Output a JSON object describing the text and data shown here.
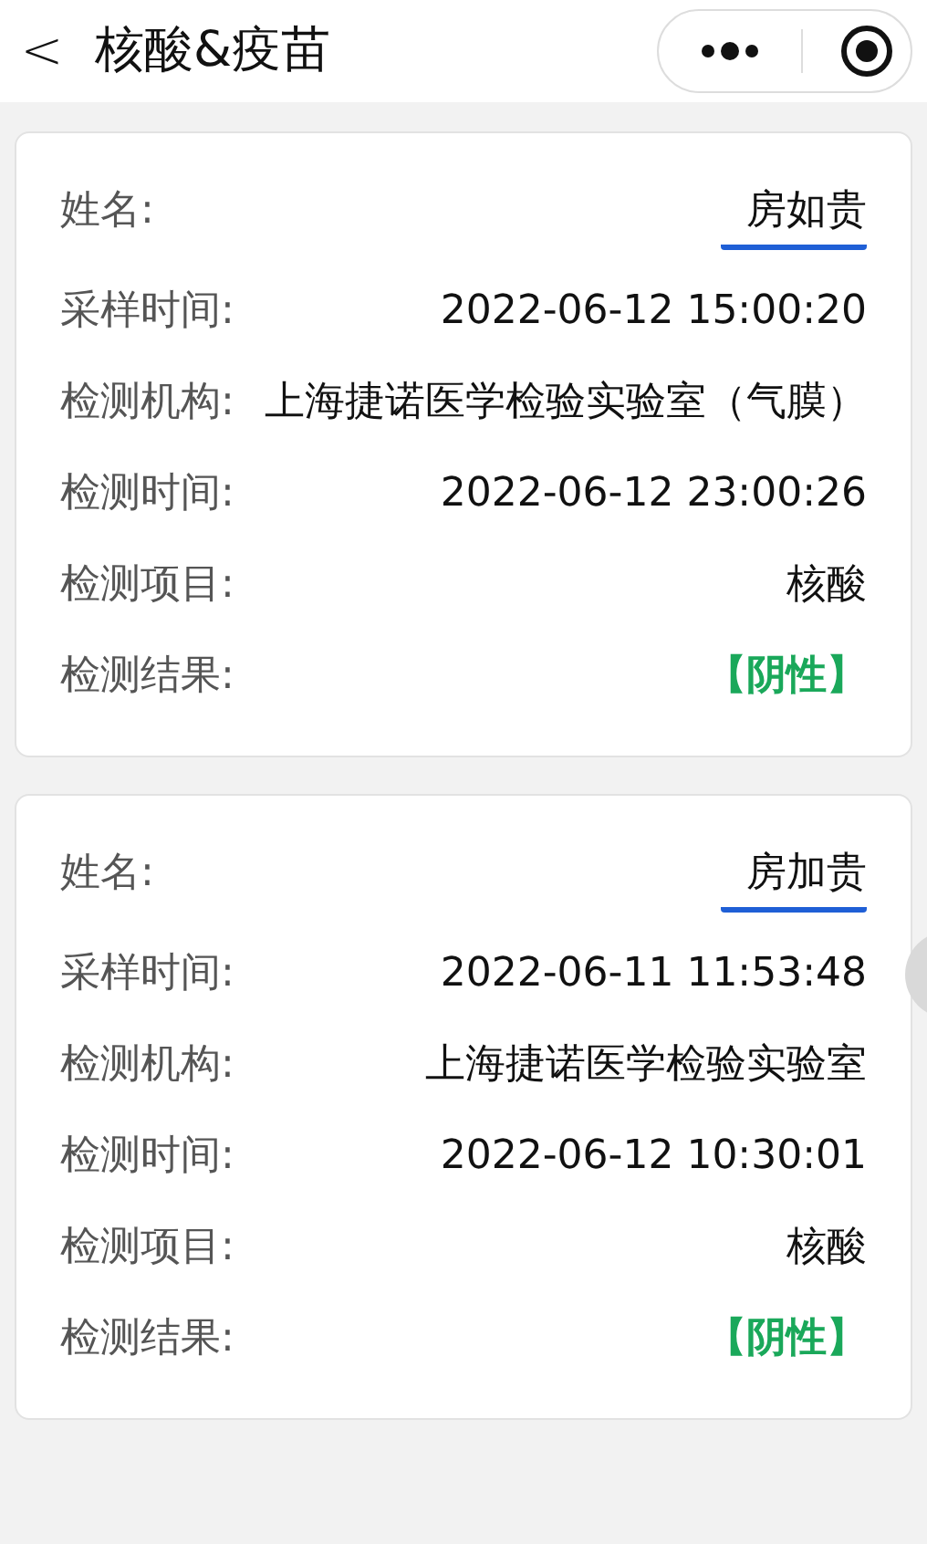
{
  "header": {
    "back": "<",
    "title": "核酸&疫苗"
  },
  "records": [
    {
      "name_underlined": true,
      "fields": [
        {
          "kind": "name",
          "label": "姓名:",
          "value": "房如贵"
        },
        {
          "kind": "text",
          "label": "采样时间:",
          "value": "2022-06-12 15:00:20"
        },
        {
          "kind": "text",
          "label": "检测机构:",
          "value": "上海捷诺医学检验实验室（气膜）"
        },
        {
          "kind": "text",
          "label": "检测时间:",
          "value": "2022-06-12 23:00:26"
        },
        {
          "kind": "text",
          "label": "检测项目:",
          "value": "核酸"
        },
        {
          "kind": "result",
          "label": "检测结果:",
          "value": "【阴性】"
        }
      ]
    },
    {
      "name_underlined": true,
      "fields": [
        {
          "kind": "name",
          "label": "姓名:",
          "value": "房加贵"
        },
        {
          "kind": "text",
          "label": "采样时间:",
          "value": "2022-06-11 11:53:48"
        },
        {
          "kind": "text",
          "label": "检测机构:",
          "value": "上海捷诺医学检验实验室"
        },
        {
          "kind": "text",
          "label": "检测时间:",
          "value": "2022-06-12 10:30:01"
        },
        {
          "kind": "text",
          "label": "检测项目:",
          "value": "核酸"
        },
        {
          "kind": "result",
          "label": "检测结果:",
          "value": "【阴性】"
        }
      ]
    }
  ]
}
